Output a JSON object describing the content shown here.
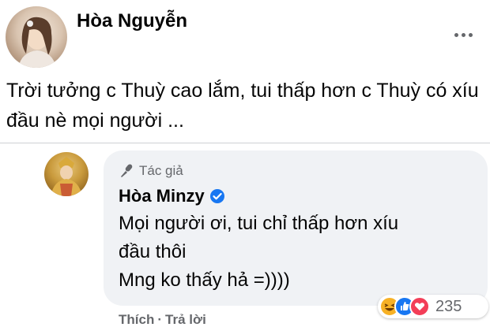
{
  "post": {
    "author": "Hòa Nguyễn",
    "text": "Trời tưởng c Thuỳ cao lắm, tui thấp hơn c Thuỳ có xíu đầu nè mọi người ..."
  },
  "comment": {
    "badge": "Tác giả",
    "author": "Hòa Minzy",
    "text": "Mọi người ơi, tui chỉ thấp hơn xíu\nđầu thôi\nMng ko thấy hả =))))",
    "reaction_icons": [
      "haha-icon",
      "like-icon",
      "love-icon"
    ],
    "reaction_count": "235",
    "actions": {
      "like": "Thích",
      "separator": "·",
      "reply": "Trả lời"
    }
  },
  "colors": {
    "verified": "#1877f2",
    "secondary_text": "#65676b",
    "bubble": "#f0f2f5",
    "love": "#f33e58",
    "like": "#1877f2",
    "haha": "#f7b125"
  }
}
